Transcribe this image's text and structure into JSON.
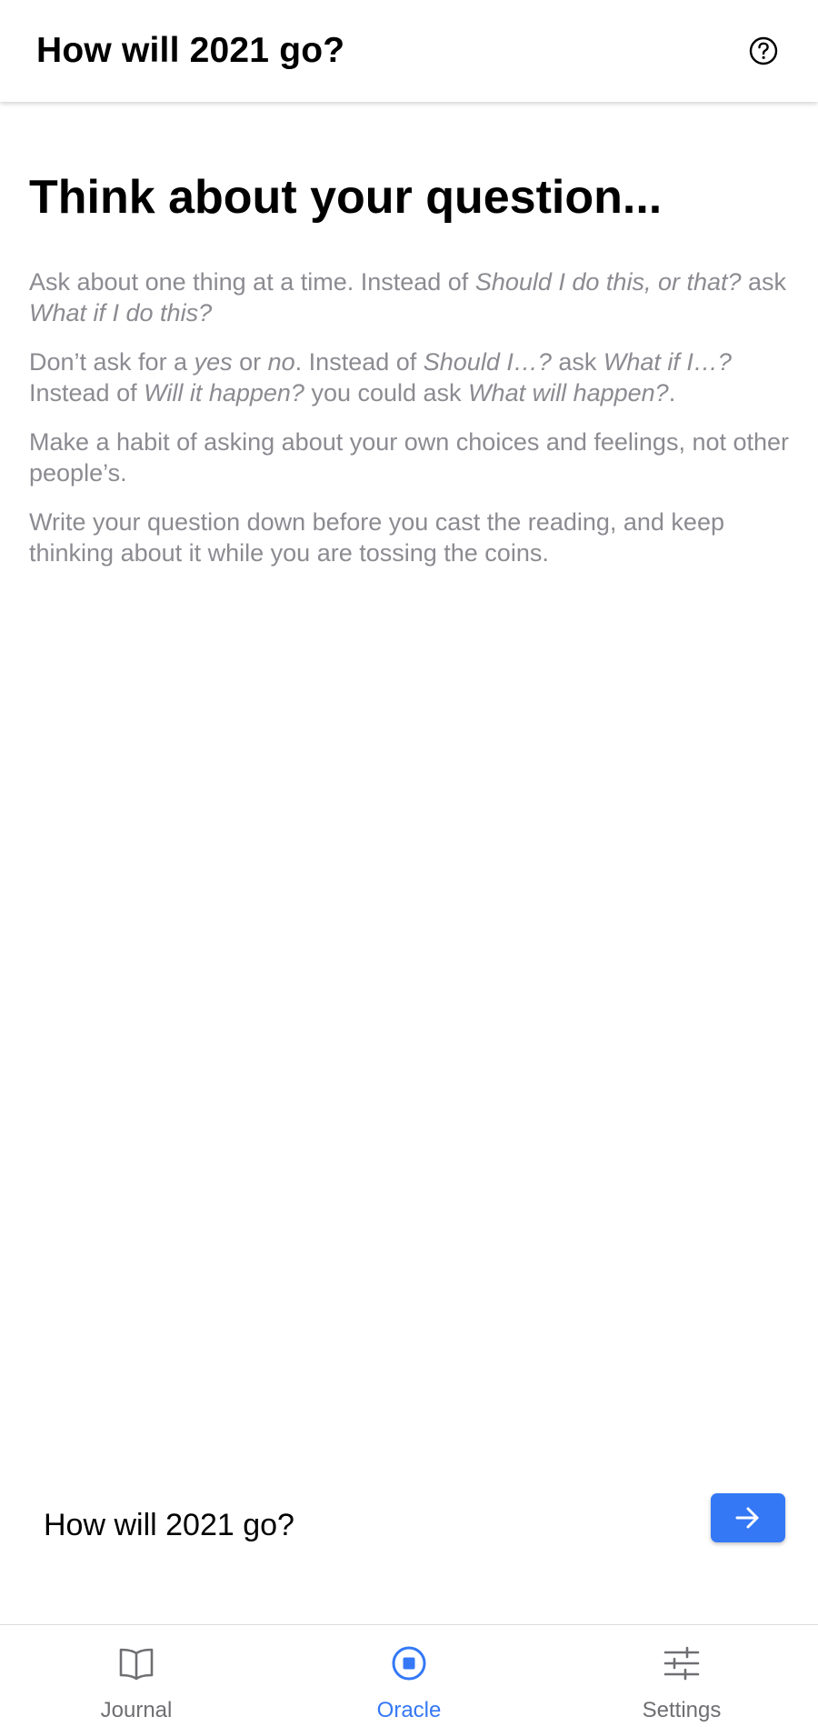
{
  "header": {
    "title": "How will 2021 go?",
    "help_icon": "question-circle-icon"
  },
  "main": {
    "heading": "Think about your question...",
    "tips": {
      "t1_a": "Ask about one thing at a time. Instead of ",
      "t1_b": "Should I do this, or that?",
      "t1_c": " ask ",
      "t1_d": "What if I do this?",
      "t2_a": "Don’t ask for a ",
      "t2_b": "yes",
      "t2_c": " or ",
      "t2_d": "no",
      "t2_e": ". Instead of ",
      "t2_f": "Should I…?",
      "t2_g": " ask ",
      "t2_h": "What if I…?",
      "t2_i": " Instead of ",
      "t2_j": "Will it happen?",
      "t2_k": " you could ask ",
      "t2_l": "What will happen?",
      "t2_m": ".",
      "t3": "Make a habit of asking about your own choices and feelings, not other people’s.",
      "t4": "Write your question down before you cast the reading, and keep thinking about it while you are tossing the coins."
    }
  },
  "question": {
    "value": "How will 2021 go?",
    "submit_icon": "arrow-right-icon"
  },
  "tabbar": {
    "tabs": [
      {
        "label": "Journal",
        "icon": "book-icon",
        "active": false
      },
      {
        "label": "Oracle",
        "icon": "oracle-circle-icon",
        "active": true
      },
      {
        "label": "Settings",
        "icon": "sliders-icon",
        "active": false
      }
    ]
  },
  "colors": {
    "accent": "#3478f6",
    "tip_text": "#8b8b91",
    "tab_inactive": "#6f6f73"
  }
}
